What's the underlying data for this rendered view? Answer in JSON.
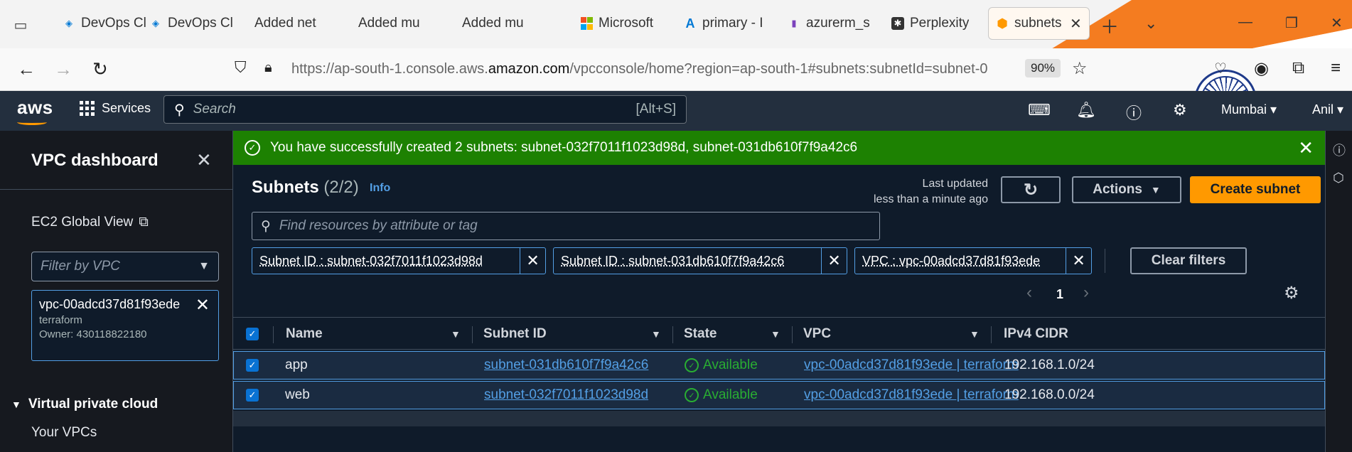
{
  "browser": {
    "tabs": [
      {
        "label": "DevOps Cl",
        "icon": "azure-devops-icon"
      },
      {
        "label": "DevOps Cl",
        "icon": "azure-devops-icon"
      },
      {
        "label": "Added net",
        "icon": ""
      },
      {
        "label": "Added mu",
        "icon": ""
      },
      {
        "label": "Added mu",
        "icon": ""
      },
      {
        "label": "Microsoft",
        "icon": "microsoft-icon"
      },
      {
        "label": "primary - I",
        "icon": "azure-icon"
      },
      {
        "label": "azurerm_s",
        "icon": "terraform-icon"
      },
      {
        "label": "Perplexity",
        "icon": "perplexity-icon"
      },
      {
        "label": "subnets",
        "icon": "aws-icon"
      }
    ],
    "url_prefix": "https://ap-south-1.console.aws.",
    "url_domain": "amazon.com",
    "url_suffix": "/vpcconsole/home?region=ap-south-1#subnets:subnetId=subnet-0",
    "zoom": "90%"
  },
  "aws_nav": {
    "logo": "aws",
    "services_label": "Services",
    "search_placeholder": "Search",
    "search_hint": "[Alt+S]",
    "region": "Mumbai",
    "user": "Anil"
  },
  "sidebar": {
    "title": "VPC dashboard",
    "ec2_global_view": "EC2 Global View",
    "filter_placeholder": "Filter by VPC",
    "selected_vpc": {
      "id": "vpc-00adcd37d81f93ede",
      "name": "terraform",
      "owner": "Owner: 430118822180"
    },
    "section": "Virtual private cloud",
    "items": [
      "Your VPCs"
    ]
  },
  "flash": {
    "message": "You have successfully created 2 subnets: subnet-032f7011f1023d98d, subnet-031db610f7f9a42c6"
  },
  "header": {
    "title": "Subnets",
    "count": "(2/2)",
    "info": "Info",
    "last_updated_label": "Last updated",
    "last_updated_value": "less than a minute ago",
    "actions_label": "Actions",
    "create_label": "Create subnet"
  },
  "filter": {
    "placeholder": "Find resources by attribute or tag",
    "tokens": [
      "Subnet ID : subnet-032f7011f1023d98d",
      "Subnet ID : subnet-031db610f7f9a42c6",
      "VPC : vpc-00adcd37d81f93ede"
    ],
    "clear_label": "Clear filters",
    "page": "1"
  },
  "table": {
    "columns": [
      "Name",
      "Subnet ID",
      "State",
      "VPC",
      "IPv4 CIDR"
    ],
    "rows": [
      {
        "name": "app",
        "subnet_id": "subnet-031db610f7f9a42c6",
        "state": "Available",
        "vpc": "vpc-00adcd37d81f93ede | terraform",
        "cidr": "192.168.1.0/24"
      },
      {
        "name": "web",
        "subnet_id": "subnet-032f7011f1023d98d",
        "state": "Available",
        "vpc": "vpc-00adcd37d81f93ede | terraform",
        "cidr": "192.168.0.0/24"
      }
    ]
  },
  "colors": {
    "accent": "#ff9900",
    "success": "#1d8102",
    "link": "#539fe5",
    "nav_bg": "#232f3e"
  }
}
